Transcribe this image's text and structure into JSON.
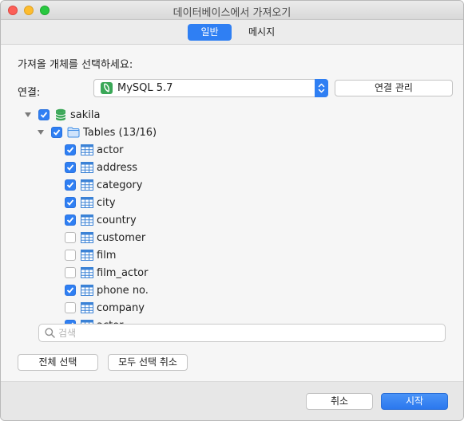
{
  "window": {
    "title": "데이터베이스에서 가져오기"
  },
  "tabs": [
    {
      "label": "일반",
      "active": true
    },
    {
      "label": "메시지",
      "active": false
    }
  ],
  "instruction": "가져올 개체를 선택하세요:",
  "connection": {
    "label": "연결:",
    "selected": "MySQL 5.7",
    "manage_button": "연결 관리"
  },
  "tree": {
    "database": {
      "name": "sakila",
      "checked": true,
      "expanded": true,
      "icon": "database-icon"
    },
    "tables_folder": {
      "label": "Tables (13/16)",
      "checked": true,
      "expanded": true,
      "icon": "folder-icon"
    },
    "tables": [
      {
        "name": "actor",
        "checked": true
      },
      {
        "name": "address",
        "checked": true
      },
      {
        "name": "category",
        "checked": true
      },
      {
        "name": "city",
        "checked": true
      },
      {
        "name": "country",
        "checked": true
      },
      {
        "name": "customer",
        "checked": false
      },
      {
        "name": "film",
        "checked": false
      },
      {
        "name": "film_actor",
        "checked": false
      },
      {
        "name": "phone no.",
        "checked": true
      },
      {
        "name": "company",
        "checked": false
      },
      {
        "name": "actor",
        "checked": true
      }
    ]
  },
  "search": {
    "placeholder": "검색",
    "value": ""
  },
  "buttons": {
    "select_all": "전체 선택",
    "deselect_all": "모두 선택 취소",
    "cancel": "취소",
    "start": "시작"
  },
  "colors": {
    "accent": "#2f7ff3",
    "db_green": "#3aa757",
    "table_blue": "#3b82d6"
  }
}
